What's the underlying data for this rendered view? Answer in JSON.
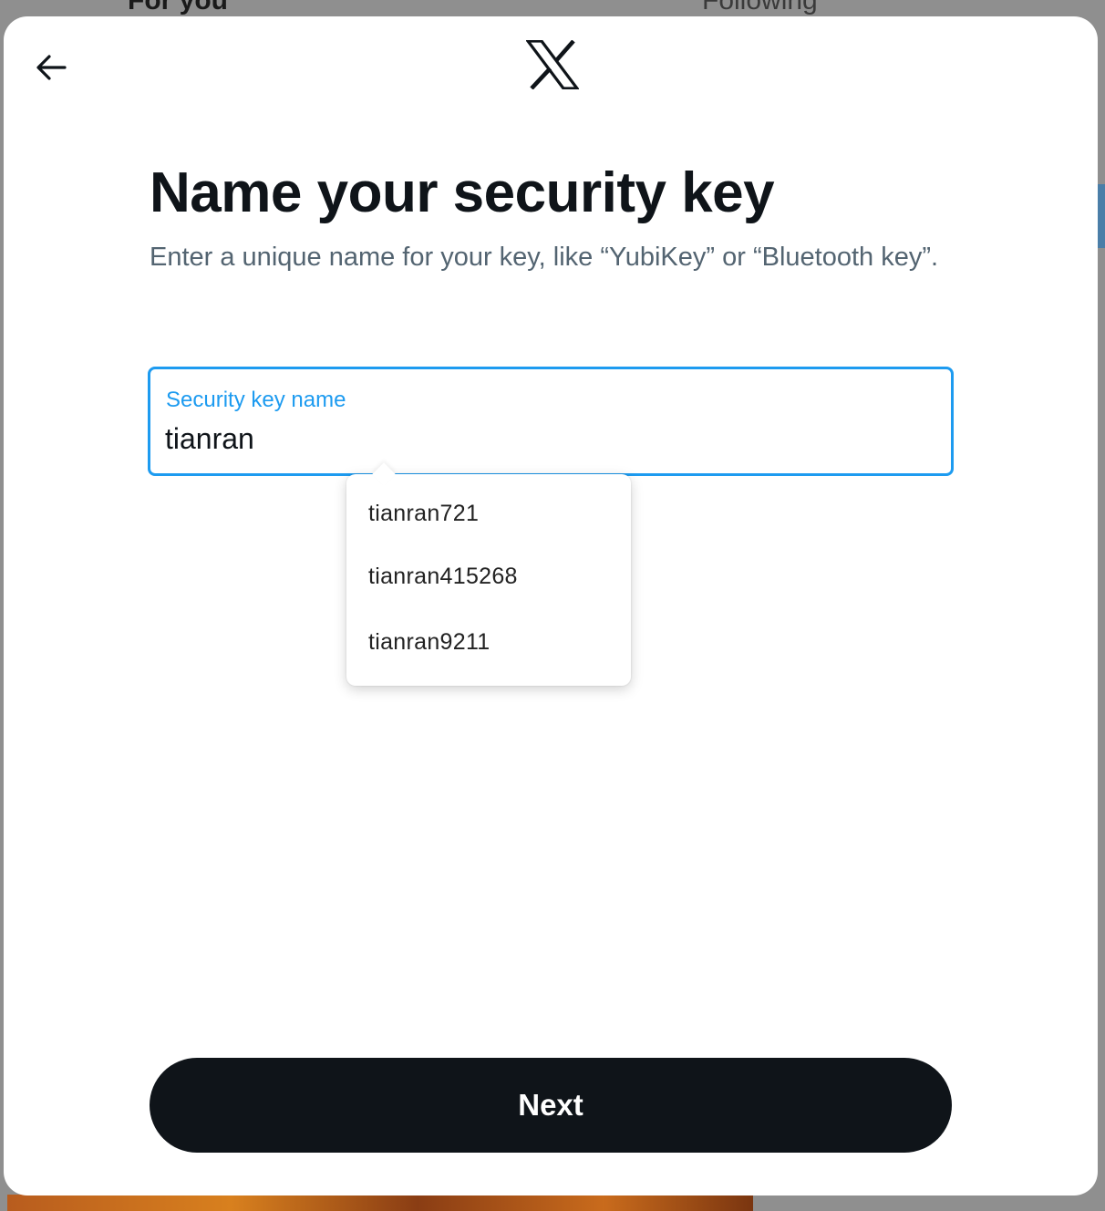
{
  "background": {
    "tabs": [
      "For you",
      "Following"
    ]
  },
  "header": {
    "back_icon": "arrow-left-icon",
    "logo_icon": "x-logo-icon"
  },
  "main": {
    "title": "Name your security key",
    "subtitle": "Enter a unique name for your key, like “YubiKey” or “Bluetooth key”."
  },
  "field": {
    "label": "Security key name",
    "value": "tianran"
  },
  "autocomplete": {
    "items": [
      "tianran721",
      "tianran415268",
      "tianran9211"
    ]
  },
  "footer": {
    "next_label": "Next"
  },
  "colors": {
    "accent": "#1d9bf0",
    "text_primary": "#0f1419",
    "text_secondary": "#536471",
    "button_bg": "#0f1419"
  }
}
